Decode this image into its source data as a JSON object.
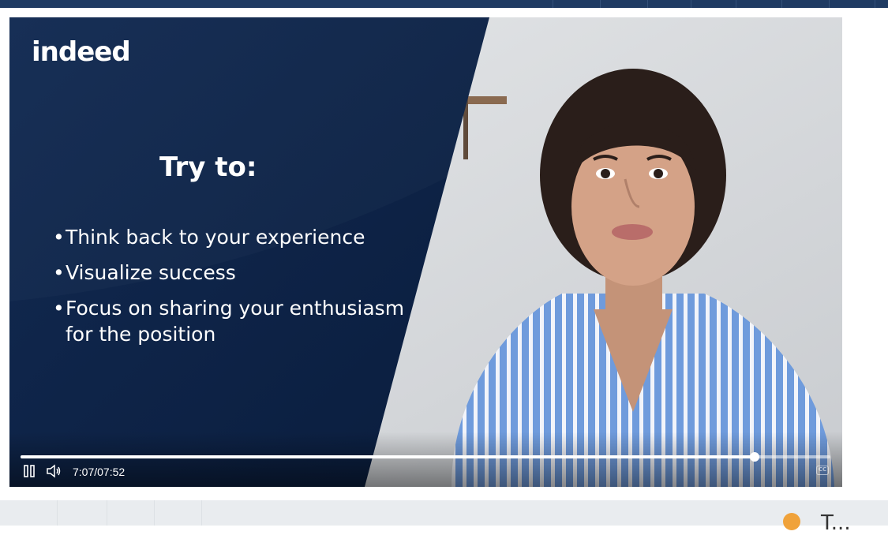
{
  "logo": {
    "text": "indeed"
  },
  "slide": {
    "title": "Try to:",
    "bullets": [
      "Think back to your experience",
      "Visualize success",
      "Focus on sharing your enthusiasm for the position"
    ]
  },
  "player": {
    "time_display": "7:07/07:52",
    "progress": 0.906,
    "play_state": "playing",
    "icons": {
      "pause": "pause-icon",
      "volume": "volume-icon",
      "captions": "closed-captions-icon"
    },
    "captions_label": "CC"
  },
  "colors": {
    "slide_bg": "#0d2347",
    "accent": "#ffffff",
    "top_bar": "#1f3b63"
  },
  "footer": {
    "partial_text": "T..."
  }
}
